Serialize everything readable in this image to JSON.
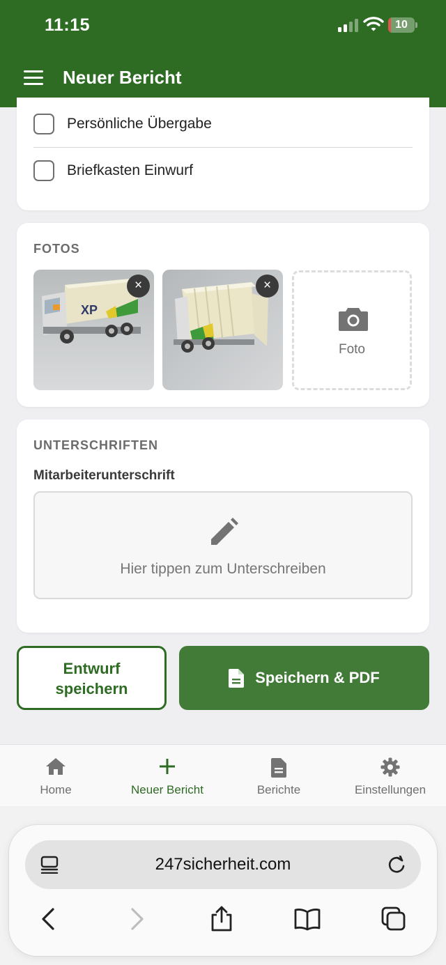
{
  "status_bar": {
    "time": "11:15",
    "battery": "10",
    "battery_fraction": 0.1
  },
  "header": {
    "title": "Neuer Bericht",
    "menu_icon": "hamburger-menu-icon"
  },
  "delivery_options": [
    {
      "label": "Persönliche Übergabe",
      "checked": false
    },
    {
      "label": "Briefkasten Einwurf",
      "checked": false
    }
  ],
  "photos": {
    "title": "FOTOS",
    "items": [
      {
        "icon": "photo-toy-truck-side",
        "remove_label": "×"
      },
      {
        "icon": "photo-toy-truck-rear-open",
        "remove_label": "×"
      }
    ],
    "add_label": "Foto",
    "add_icon": "camera-icon"
  },
  "signatures": {
    "title": "UNTERSCHRIFTEN",
    "employee_label": "Mitarbeiterunterschrift",
    "placeholder": "Hier tippen zum Unterschreiben",
    "icon": "pen-icon"
  },
  "actions": {
    "draft_line1": "Entwurf",
    "draft_line2": "speichern",
    "save_pdf": "Speichern & PDF",
    "save_icon": "document-icon"
  },
  "bottom_nav": [
    {
      "label": "Home",
      "icon": "home-icon",
      "active": false
    },
    {
      "label": "Neuer Bericht",
      "icon": "plus-icon",
      "active": true
    },
    {
      "label": "Berichte",
      "icon": "document-icon",
      "active": false
    },
    {
      "label": "Einstellungen",
      "icon": "gear-icon",
      "active": false
    }
  ],
  "browser": {
    "url": "247sicherheit.com"
  },
  "colors": {
    "primary": "#2e6b23",
    "primary_button": "#427b38",
    "background": "#efeff2",
    "muted_text": "#6e6e6e"
  }
}
